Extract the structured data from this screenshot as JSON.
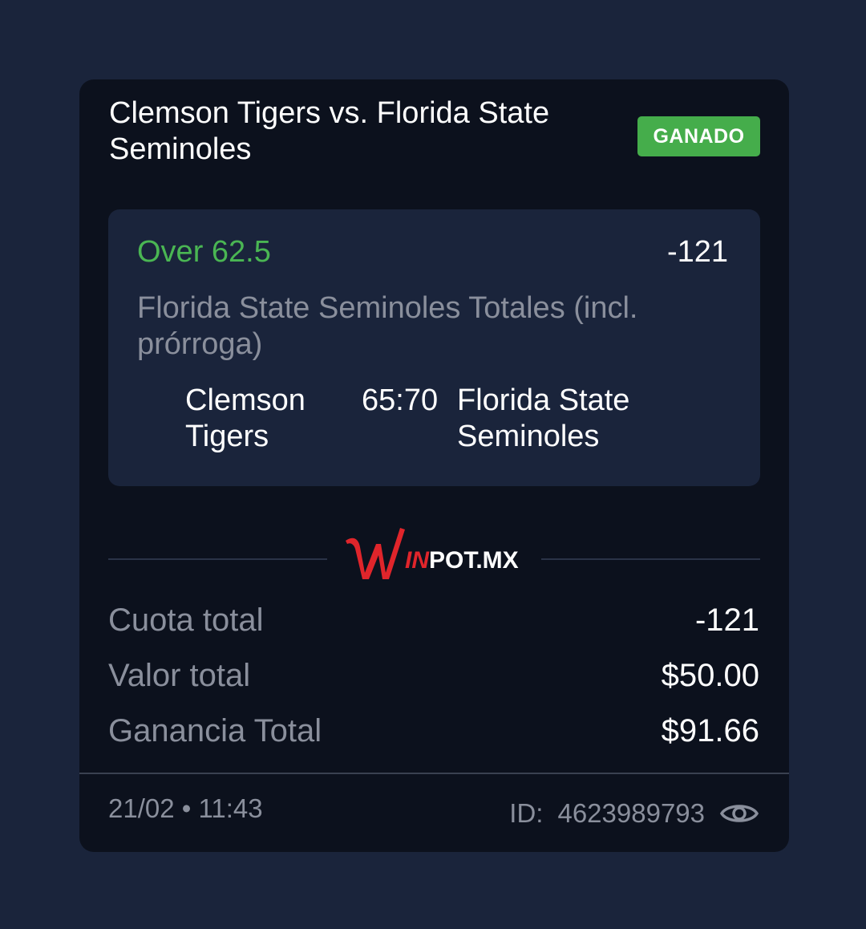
{
  "event": {
    "title": "Clemson Tigers vs. Florida State Seminoles",
    "status": "GANADO"
  },
  "selection": {
    "pick": "Over 62.5",
    "odds": "-121",
    "market": "Florida State Seminoles Totales (incl. prórroga)",
    "home_team": "Clemson Tigers",
    "score": "65:70",
    "away_team": "Florida State Seminoles"
  },
  "brand": {
    "logo_text_w": "W",
    "logo_text_in": "IN",
    "logo_text_rest": "POT.MX"
  },
  "summary": {
    "odds_label": "Cuota total",
    "odds_value": "-121",
    "stake_label": "Valor total",
    "stake_value": "$50.00",
    "payout_label": "Ganancia Total",
    "payout_value": "$91.66"
  },
  "footer": {
    "datetime": "21/02 • 11:43",
    "id_label": "ID:",
    "id_value": "4623989793",
    "view_icon": "eye-icon"
  },
  "colors": {
    "background": "#1a243b",
    "card": "#0c111d",
    "win_badge": "#45ad4b",
    "pick_green": "#4ab653",
    "brand_red": "#e0252b"
  }
}
